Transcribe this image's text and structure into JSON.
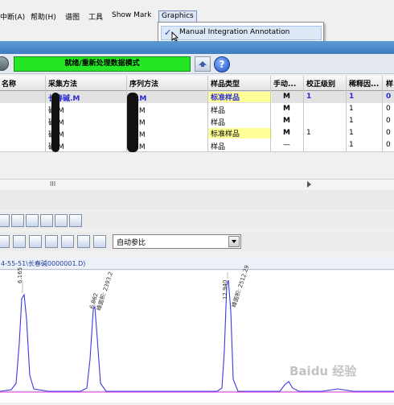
{
  "menu": {
    "items": [
      "中断(A)",
      "帮助(H)",
      "谱图",
      "工具",
      "Show Mark",
      "Graphics"
    ],
    "dropdown_check": "✓",
    "dropdown_item": "Manual Integration Annotation"
  },
  "toolbar": {
    "status": "就绪/重新处理数据模式"
  },
  "grid": {
    "headers": [
      "名称",
      "采集方法",
      "序列方法",
      "样品类型",
      "手动...",
      "校正级别",
      "稀释因...",
      "样"
    ],
    "rows": [
      {
        "acq": "长春碱.M",
        "seq": "碱.M",
        "type": "标准样品",
        "manual": "M",
        "level": "1",
        "dil": "1",
        "s": "0"
      },
      {
        "acq": "碱.M",
        "seq": "碱.M",
        "type": "样品",
        "manual": "M",
        "level": "",
        "dil": "1",
        "s": "0"
      },
      {
        "acq": "碱.M",
        "seq": "碱.M",
        "type": "样品",
        "manual": "M",
        "level": "",
        "dil": "1",
        "s": "0"
      },
      {
        "acq": "碱.M",
        "seq": "碱.M",
        "type": "标准样品",
        "manual": "M",
        "level": "1",
        "dil": "1",
        "s": "0"
      },
      {
        "acq": "碱.M",
        "seq": "碱.M",
        "type": "样品",
        "manual": "—",
        "level": "",
        "dil": "1",
        "s": "0"
      }
    ],
    "scroll_marker": "III"
  },
  "reference_select": "自动参比",
  "chromatogram": {
    "title": "4-55-51\\长春碱0000001.D)",
    "peaks": [
      {
        "time": "6.165",
        "area": ""
      },
      {
        "time": "6.862",
        "area": "峰面积: 2393.2"
      },
      {
        "time": "12.940",
        "area": "峰面积: 2512.29"
      }
    ]
  },
  "watermark": "Baidu 经验"
}
